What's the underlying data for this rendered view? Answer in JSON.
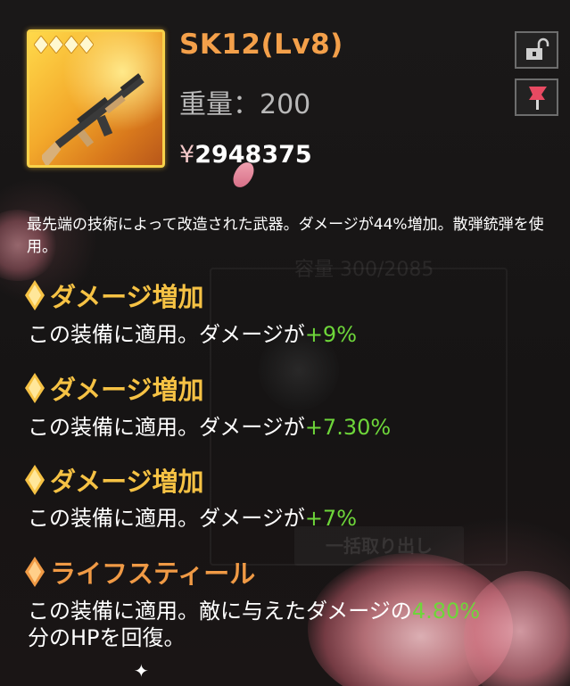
{
  "item": {
    "name": "SK12(Lv8)",
    "weight_label": "重量：",
    "weight_value": "200",
    "currency_symbol": "¥",
    "price": "2948375",
    "rarity_stars": 4,
    "icon": "assault-rifle-icon"
  },
  "buttons": {
    "lock_icon": "unlock-icon",
    "pin_icon": "pin-icon"
  },
  "description": "最先端の技術によって改造された武器。ダメージが44%増加。散弾銃弾を使用。",
  "effects": [
    {
      "title": "ダメージ増加",
      "desc_prefix": "この装備に適用。ダメージが",
      "value": "+9%",
      "desc_suffix": ""
    },
    {
      "title": "ダメージ増加",
      "desc_prefix": "この装備に適用。ダメージが",
      "value": "+7.30%",
      "desc_suffix": ""
    },
    {
      "title": "ダメージ増加",
      "desc_prefix": "この装備に適用。ダメージが",
      "value": "+7%",
      "desc_suffix": ""
    },
    {
      "title": "ライフスティール",
      "desc_prefix": "この装備に適用。敵に与えたダメージの",
      "value": "4.80%",
      "desc_suffix": "分のHPを回復。"
    }
  ],
  "background": {
    "capacity_text": "容量 300/2085",
    "retrieve_label": "一括取り出し"
  },
  "colors": {
    "name": "#f4a04a",
    "effect_title_gold": "#f6c244",
    "effect_title_orange": "#f09a45",
    "value_green": "#6ed63a",
    "frame_gold": "#f8d24a"
  }
}
